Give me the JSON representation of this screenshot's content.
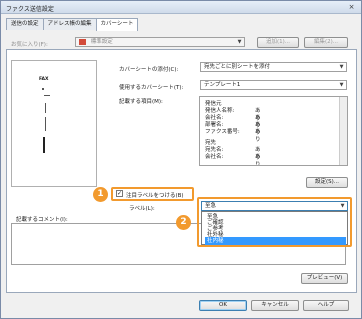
{
  "window": {
    "title": "ファクス送信設定",
    "close_glyph": "×"
  },
  "tabs": [
    {
      "label": "送信の設定"
    },
    {
      "label": "アドレス帳の編集"
    },
    {
      "label": "カバーシート"
    }
  ],
  "favorites": {
    "label": "お気に入り(F):",
    "value": "標準設定",
    "add_label": "追加(1)...",
    "edit_label": "編集(2)..."
  },
  "cover": {
    "attach_label": "カバーシートの添付(C):",
    "attach_value": "宛先ごとに別シートを添付",
    "template_label": "使用するカバーシート(T):",
    "template_value": "テンプレート1",
    "items_label": "記載する項目(M):",
    "items": [
      {
        "name": "発信元",
        "value": ""
      },
      {
        "name": "発信人名称:",
        "value": "あり"
      },
      {
        "name": "会社名:",
        "value": "あり"
      },
      {
        "name": "部署名:",
        "value": "あり"
      },
      {
        "name": "ファクス番号:",
        "value": "あり"
      },
      {
        "name": "宛先",
        "value": ""
      },
      {
        "name": "宛先名:",
        "value": "あり"
      },
      {
        "name": "会社名:",
        "value": "あり"
      }
    ],
    "settings_button": "設定(S)..."
  },
  "preview": {
    "fax_mark": "FAX"
  },
  "attention": {
    "checkbox_label": "注目ラベルをつける(B)",
    "checked_glyph": "✓",
    "label_label": "ラベル(L):",
    "label_value": "至急"
  },
  "dropdown_options": [
    "至急",
    "ご確認",
    "ご参考",
    "社外秘",
    "社内秘"
  ],
  "comment_label": "記載するコメント(I):",
  "badges": {
    "one": "1",
    "two": "2"
  },
  "buttons": {
    "preview": "プレビュー(V)",
    "ok": "OK",
    "cancel": "キャンセル",
    "help": "ヘルプ"
  },
  "arrow_glyph": "▼"
}
